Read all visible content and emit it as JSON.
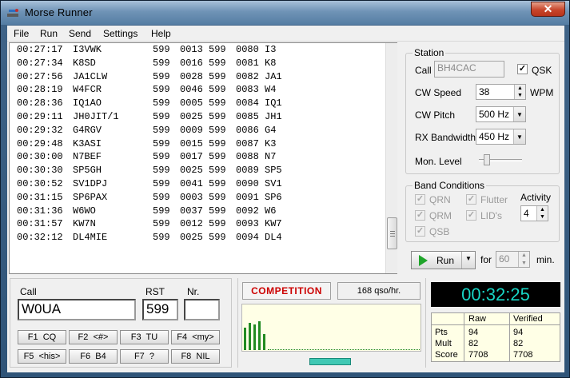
{
  "window": {
    "title": "Morse Runner",
    "close_label": "✕"
  },
  "menu": [
    "File",
    "Run",
    "Send",
    "Settings",
    "Help"
  ],
  "log": [
    [
      "00:27:17",
      "I3VWK",
      "599",
      "0013",
      "599",
      "0080",
      "I3"
    ],
    [
      "00:27:34",
      "K8SD",
      "599",
      "0016",
      "599",
      "0081",
      "K8"
    ],
    [
      "00:27:56",
      "JA1CLW",
      "599",
      "0028",
      "599",
      "0082",
      "JA1"
    ],
    [
      "00:28:19",
      "W4FCR",
      "599",
      "0046",
      "599",
      "0083",
      "W4"
    ],
    [
      "00:28:36",
      "IQ1AO",
      "599",
      "0005",
      "599",
      "0084",
      "IQ1"
    ],
    [
      "00:29:11",
      "JH0JIT/1",
      "599",
      "0025",
      "599",
      "0085",
      "JH1"
    ],
    [
      "00:29:32",
      "G4RGV",
      "599",
      "0009",
      "599",
      "0086",
      "G4"
    ],
    [
      "00:29:48",
      "K3ASI",
      "599",
      "0015",
      "599",
      "0087",
      "K3"
    ],
    [
      "00:30:00",
      "N7BEF",
      "599",
      "0017",
      "599",
      "0088",
      "N7"
    ],
    [
      "00:30:30",
      "SP5GH",
      "599",
      "0025",
      "599",
      "0089",
      "SP5"
    ],
    [
      "00:30:52",
      "SV1DPJ",
      "599",
      "0041",
      "599",
      "0090",
      "SV1"
    ],
    [
      "00:31:15",
      "SP6PAX",
      "599",
      "0003",
      "599",
      "0091",
      "SP6"
    ],
    [
      "00:31:36",
      "W6WO",
      "599",
      "0037",
      "599",
      "0092",
      "W6"
    ],
    [
      "00:31:57",
      "KW7N",
      "599",
      "0012",
      "599",
      "0093",
      "KW7"
    ],
    [
      "00:32:12",
      "DL4MIE",
      "599",
      "0025",
      "599",
      "0094",
      "DL4"
    ]
  ],
  "station": {
    "title": "Station",
    "call_label": "Call",
    "call_value": "BH4CAC",
    "qsk_label": "QSK",
    "qsk_checked": "✓",
    "cw_speed_label": "CW Speed",
    "cw_speed_value": "38",
    "cw_speed_unit": "WPM",
    "cw_pitch_label": "CW Pitch",
    "cw_pitch_value": "500 Hz",
    "rx_bw_label": "RX Bandwidth",
    "rx_bw_value": "450 Hz",
    "mon_level_label": "Mon. Level"
  },
  "band": {
    "title": "Band Conditions",
    "qrn": "QRN",
    "qrm": "QRM",
    "qsb": "QSB",
    "flutter": "Flutter",
    "lids": "LID's",
    "check": "✓",
    "activity_label": "Activity",
    "activity_value": "4"
  },
  "run": {
    "label": "Run",
    "for_label": "for",
    "minutes": "60",
    "min_label": "min."
  },
  "entry": {
    "call_label": "Call",
    "call_value": "W0UA",
    "rst_label": "RST",
    "rst_value": "599",
    "nr_label": "Nr.",
    "nr_value": ""
  },
  "fkeys": [
    "F1  CQ",
    "F2  <#>",
    "F3  TU",
    "F4  <my>",
    "F5  <his>",
    "F6  B4",
    "F7  ?",
    "F8  NIL"
  ],
  "status": {
    "mode": "COMPETITION",
    "rate": "168  qso/hr."
  },
  "rate_bars": [
    14,
    17,
    16,
    18,
    10
  ],
  "progress_percent": 18,
  "clock": "00:32:25",
  "score": {
    "raw_label": "Raw",
    "verified_label": "Verified",
    "rows": [
      {
        "label": "Pts",
        "raw": "94",
        "verified": "94"
      },
      {
        "label": "Mult",
        "raw": "82",
        "verified": "82"
      },
      {
        "label": "Score",
        "raw": "7708",
        "verified": "7708"
      }
    ]
  },
  "icons": {
    "app": "morse-key-icon",
    "down": "chevron-down-icon",
    "up": "chevron-up-icon",
    "play": "play-icon"
  }
}
